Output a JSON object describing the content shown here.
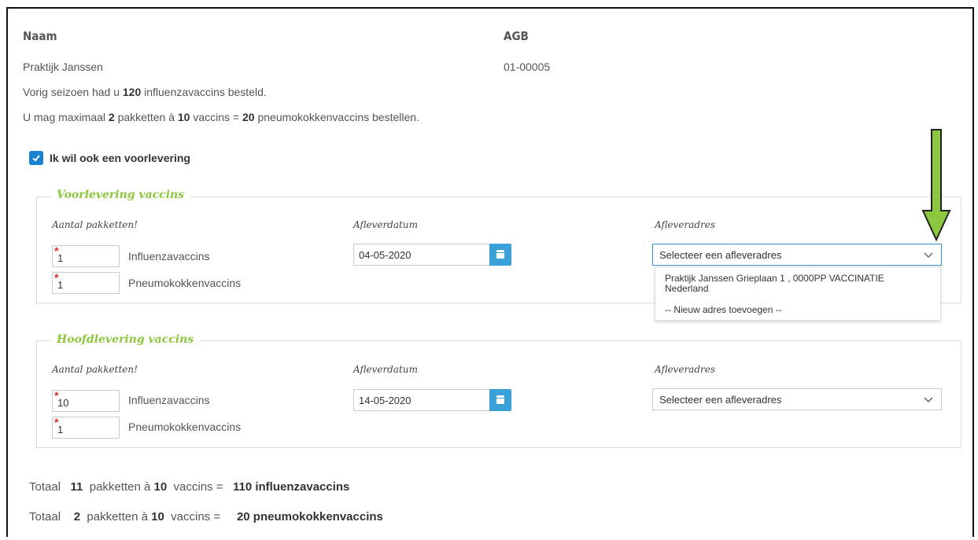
{
  "header": {
    "name_label": "Naam",
    "agb_label": "AGB",
    "name_value": "Praktijk Janssen",
    "agb_value": "01-00005"
  },
  "info": {
    "line1_pre": "Vorig seizoen had u ",
    "line1_num": "120",
    "line1_post": " influenzavaccins besteld.",
    "line2_pre": "U mag maximaal ",
    "line2_n1": "2",
    "line2_mid1": " pakketten à ",
    "line2_n2": "10",
    "line2_mid2": " vaccins = ",
    "line2_n3": "20",
    "line2_post": " pneumokokkenvaccins bestellen."
  },
  "preorder": {
    "checkbox_label": "Ik wil ook een voorlevering",
    "checked": true
  },
  "voorlevering": {
    "legend": "Voorlevering vaccins",
    "col_qty": "Aantal pakketten!",
    "col_date": "Afleverdatum",
    "col_addr": "Afleveradres",
    "influenza_qty": "1",
    "influenza_label": "Influenzavaccins",
    "pneumo_qty": "1",
    "pneumo_label": "Pneumokokkenvaccins",
    "date": "04-05-2020",
    "address_placeholder": "Selecteer een afleveradres",
    "dropdown_open": true,
    "dropdown_options": [
      "Praktijk Janssen Grieplaan 1 , 0000PP VACCINATIE Nederland",
      "-- Nieuw adres toevoegen --"
    ]
  },
  "hoofdlevering": {
    "legend": "Hoofdlevering vaccins",
    "col_qty": "Aantal pakketten!",
    "col_date": "Afleverdatum",
    "col_addr": "Afleveradres",
    "influenza_qty": "10",
    "influenza_label": "Influenzavaccins",
    "pneumo_qty": "1",
    "pneumo_label": "Pneumokokkenvaccins",
    "date": "14-05-2020",
    "address_placeholder": "Selecteer een afleveradres"
  },
  "totals": [
    {
      "label": "Totaal",
      "packages": "11",
      "mid1": "pakketten à",
      "per": "10",
      "mid2": "vaccins =",
      "result": "110 influenzavaccins"
    },
    {
      "label": "Totaal",
      "packages": "2",
      "mid1": "pakketten à",
      "per": "10",
      "mid2": "vaccins =",
      "result": "20 pneumokokkenvaccins"
    }
  ],
  "annotation": {
    "arrow_color": "#8dc63f",
    "accent_blue": "#1a82d2",
    "legend_green": "#8dc63f",
    "required_red": "#d9302c"
  }
}
